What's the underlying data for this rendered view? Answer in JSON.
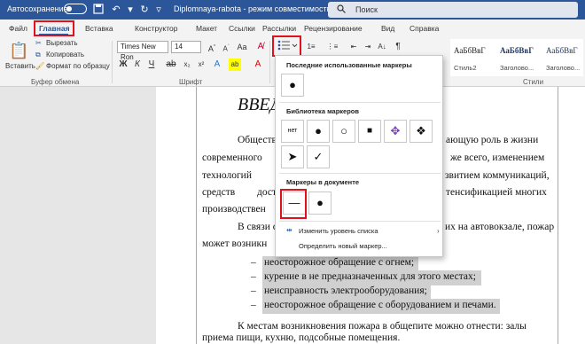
{
  "titlebar": {
    "autosave_label": "Автосохранение",
    "doc_title": "Diplomnaya-rabota  -  режим совместимости",
    "search_placeholder": "Поиск"
  },
  "tabs": [
    {
      "label": "Файл"
    },
    {
      "label": "Главная"
    },
    {
      "label": "Вставка"
    },
    {
      "label": "Конструктор"
    },
    {
      "label": "Макет"
    },
    {
      "label": "Ссылки"
    },
    {
      "label": "Рассылки"
    },
    {
      "label": "Рецензирование"
    },
    {
      "label": "Вид"
    },
    {
      "label": "Справка"
    }
  ],
  "clipboard": {
    "paste": "Вставить",
    "cut": "Вырезать",
    "copy": "Копировать",
    "format_painter": "Формат по образцу",
    "group": "Буфер обмена"
  },
  "font": {
    "name": "Times New Ron",
    "size": "14",
    "group": "Шрифт"
  },
  "styles": {
    "items": [
      {
        "sample": "АаБбВвГ",
        "name": "Стиль2"
      },
      {
        "sample": "АаБбВвГ",
        "name": "Заголово..."
      },
      {
        "sample": "АаБбВвГ",
        "name": "Заголово..."
      }
    ],
    "group": "Стили"
  },
  "bullets_dropdown": {
    "recent_title": "Последние использованные маркеры",
    "recent": [
      "●"
    ],
    "library_title": "Библиотека маркеров",
    "library": [
      "нет",
      "●",
      "○",
      "■",
      "✥",
      "❖",
      "➤",
      "✓"
    ],
    "document_title": "Маркеры в документе",
    "document": [
      "—",
      "●"
    ],
    "change_level": "Изменить уровень списка",
    "define_new": "Определить новый маркер..."
  },
  "document": {
    "heading": "ВВЕД",
    "lines": [
      "Общество",
      "ающую роль в жизни",
      "современного",
      "же всего, изменением",
      "технологий",
      "звитием коммуникаций,",
      "средств",
      "дост",
      "тенсификацией многих",
      "производствен",
      "В связи с",
      "их на автовокзале, пожар",
      "может возникн"
    ],
    "list": [
      "неосторожное обращение с огнем;",
      "курение в не предназначенных для этого местах;",
      "неисправность электрооборудования;",
      "неосторожное обращение с оборудованием и печами."
    ],
    "final_line1": "К местам возникновения пожара в общепите можно отнести: залы",
    "final_line2": "приема пищи, кухню, подсобные помещения."
  }
}
